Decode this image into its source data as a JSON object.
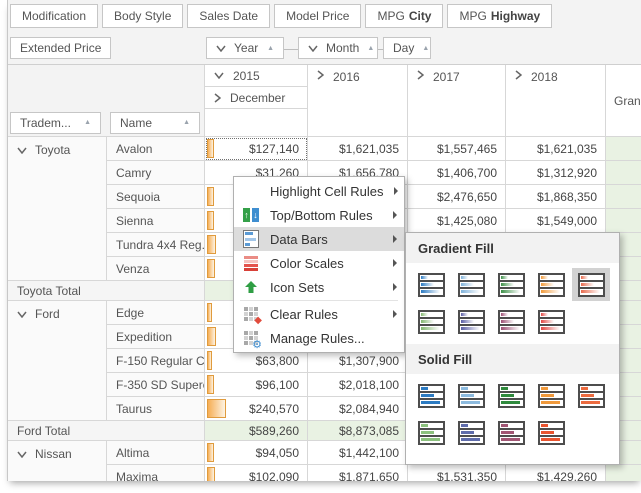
{
  "pivot": {
    "filter_chips": [
      {
        "text": "Modification"
      },
      {
        "text": "Body Style"
      },
      {
        "text": "Sales Date"
      },
      {
        "text": "Model Price"
      },
      {
        "text": "MPG",
        "bold": "City"
      },
      {
        "text": "MPG",
        "bold": "Highway"
      }
    ],
    "data_field_chip": "Extended Price",
    "column_field_chips": [
      "Year",
      "Month",
      "Day"
    ],
    "row_field_chips": [
      "Tradem...",
      "Name"
    ],
    "col_headers": {
      "y2015": "2015",
      "dec": "December",
      "y2016": "2016",
      "y2017": "2017",
      "y2018": "2018",
      "grand": "Grand Total"
    },
    "groups": [
      "Toyota",
      "Ford",
      "Nissan"
    ],
    "rows": [
      {
        "name": "Avalon",
        "v2015": "$127,140",
        "v2016": "$1,621,035",
        "v2017": "$1,557,465",
        "v2018": "$1,621,035",
        "bar": "5px"
      },
      {
        "name": "Camry",
        "v2015": "$31,260",
        "v2016": "$1,656,780",
        "v2017": "$1,406,700",
        "v2018": "$1,312,920"
      },
      {
        "name": "Sequoia",
        "v2017": "$2,476,650",
        "v2018": "$1,868,350",
        "bar": "5px"
      },
      {
        "name": "Sienna",
        "v2017": "$1,425,080",
        "v2018": "$1,549,000",
        "bar": "5px"
      },
      {
        "name": "Tundra 4x4 Reg. ...",
        "bar": "7px"
      },
      {
        "name": "Venza",
        "bar": "6px"
      },
      {
        "name": "Toyota Total"
      },
      {
        "name": "Edge",
        "bar": "3px"
      },
      {
        "name": "Expedition",
        "bar": "7px"
      },
      {
        "name": "F-150 Regular CA...",
        "v2015": "$63,800",
        "v2016": "$1,307,900",
        "bar": "3px"
      },
      {
        "name": "F-350 SD Superc...",
        "v2015": "$96,100",
        "v2016": "$2,018,100",
        "bar": "5px"
      },
      {
        "name": "Taurus",
        "v2015": "$240,570",
        "v2016": "$2,084,940",
        "bar": "17px"
      },
      {
        "name": "Ford Total",
        "v2015": "$589,260",
        "v2016": "$8,873,085"
      },
      {
        "name": "Altima",
        "v2015": "$94,050",
        "v2016": "$1,442,100",
        "bar": "5px"
      },
      {
        "name": "Maxima",
        "v2015": "$102,090",
        "v2016": "$1,871,650",
        "v2017": "$1,531,350",
        "v2018": "$1,429,260",
        "bar": "6px"
      }
    ]
  },
  "context_menu": {
    "items": [
      {
        "label": "Highlight Cell Rules"
      },
      {
        "label": "Top/Bottom Rules"
      },
      {
        "label": "Data Bars"
      },
      {
        "label": "Color Scales"
      },
      {
        "label": "Icon Sets"
      },
      {
        "label": "Clear Rules"
      },
      {
        "label": "Manage Rules..."
      }
    ],
    "selected": "Data Bars"
  },
  "format_menu": {
    "sections": [
      {
        "title": "Gradient Fill",
        "swatches": [
          {
            "color": "#2c7bc2"
          },
          {
            "color": "#7fb2da"
          },
          {
            "color": "#3d9048"
          },
          {
            "color": "#f09a3b"
          },
          {
            "color": "#e76a4d"
          },
          {
            "color": "#84b870"
          },
          {
            "color": "#5b5fa6"
          },
          {
            "color": "#9e4f74"
          },
          {
            "color": "#e24844"
          }
        ]
      },
      {
        "title": "Solid Fill",
        "swatches": [
          {
            "color": "#2c7bc2"
          },
          {
            "color": "#8cbade"
          },
          {
            "color": "#2f8a3d"
          },
          {
            "color": "#f0993b"
          },
          {
            "color": "#ec6b3f"
          },
          {
            "color": "#8cc17e"
          },
          {
            "color": "#5f6cab"
          },
          {
            "color": "#a25674"
          },
          {
            "color": "#e9542f"
          }
        ]
      }
    ],
    "selected_swatch": "gradient-orange-red"
  }
}
